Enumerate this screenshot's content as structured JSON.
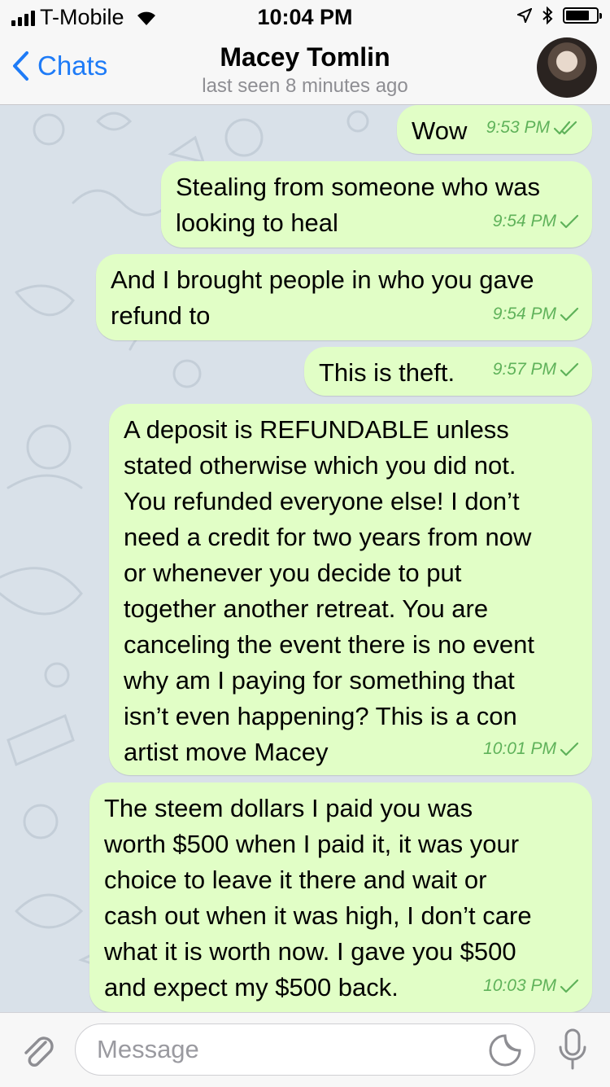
{
  "status_bar": {
    "carrier": "T-Mobile",
    "time": "10:04 PM",
    "battery_level": 0.8,
    "icons": [
      "signal-icon",
      "wifi-icon",
      "location-arrow-icon",
      "bluetooth-icon",
      "battery-icon"
    ]
  },
  "nav": {
    "back_label": "Chats",
    "contact_name": "Macey Tomlin",
    "last_seen": "last seen 8 minutes ago"
  },
  "messages": [
    {
      "text": "Wow",
      "time": "9:53 PM",
      "status": "read"
    },
    {
      "text": "Stealing from someone who was\nlooking to heal",
      "time": "9:54 PM",
      "status": "sent"
    },
    {
      "text": "And I brought people in who you gave\nrefund to",
      "time": "9:54 PM",
      "status": "sent"
    },
    {
      "text": "This is theft.",
      "time": "9:57 PM",
      "status": "sent"
    },
    {
      "text": "A deposit is REFUNDABLE unless\nstated otherwise which you did not.\nYou refunded everyone else! I don’t\nneed a credit for two years from now\nor whenever you decide to put\ntogether another retreat. You are\ncanceling the event there is no event\nwhy am I paying for something that\nisn’t even happening? This is a con\nartist move Macey",
      "time": "10:01 PM",
      "status": "sent"
    },
    {
      "text": "The steem dollars I paid you was\nworth $500 when I paid it, it was your\nchoice to leave it there and wait or\ncash out when it was high, I don’t care\nwhat it is worth now. I gave you $500\nand expect my $500 back.",
      "time": "10:03 PM",
      "status": "sent"
    }
  ],
  "input": {
    "placeholder": "Message"
  },
  "colors": {
    "accent": "#1e7bf7",
    "bubble_out": "#e1fec6",
    "check": "#5fb25a",
    "chat_bg": "#d9e1e9"
  }
}
